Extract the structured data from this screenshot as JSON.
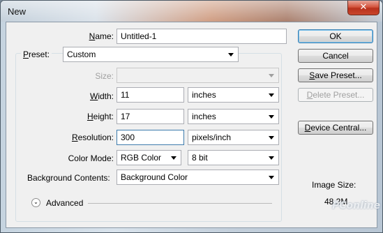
{
  "window": {
    "title": "New",
    "close_glyph": "✕"
  },
  "form": {
    "name": {
      "label_pre": "",
      "label_key": "N",
      "label_post": "ame:",
      "value": "Untitled-1"
    },
    "preset": {
      "label_pre": "",
      "label_key": "P",
      "label_post": "reset:",
      "value": "Custom"
    },
    "size": {
      "label": "Size:",
      "value": ""
    },
    "width": {
      "label_pre": "",
      "label_key": "W",
      "label_post": "idth:",
      "value": "11",
      "unit": "inches"
    },
    "height": {
      "label_pre": "",
      "label_key": "H",
      "label_post": "eight:",
      "value": "17",
      "unit": "inches"
    },
    "resolution": {
      "label_pre": "",
      "label_key": "R",
      "label_post": "esolution:",
      "value": "300",
      "unit": "pixels/inch"
    },
    "color_mode": {
      "label": "Color Mode:",
      "value": "RGB Color",
      "depth": "8 bit"
    },
    "background": {
      "label": "Background Contents:",
      "value": "Background Color"
    },
    "advanced": {
      "label": "Advanced",
      "icon": "⌄"
    }
  },
  "buttons": {
    "ok": "OK",
    "cancel": "Cancel",
    "save_preset": {
      "pre": "",
      "key": "S",
      "post": "ave Preset..."
    },
    "delete_preset": {
      "pre": "",
      "key": "D",
      "post": "elete Preset..."
    },
    "device_central": {
      "pre": "",
      "key": "D",
      "post": "evice Central..."
    }
  },
  "image_size": {
    "label": "Image Size:",
    "value": "48.2M"
  },
  "watermark": "PConline"
}
